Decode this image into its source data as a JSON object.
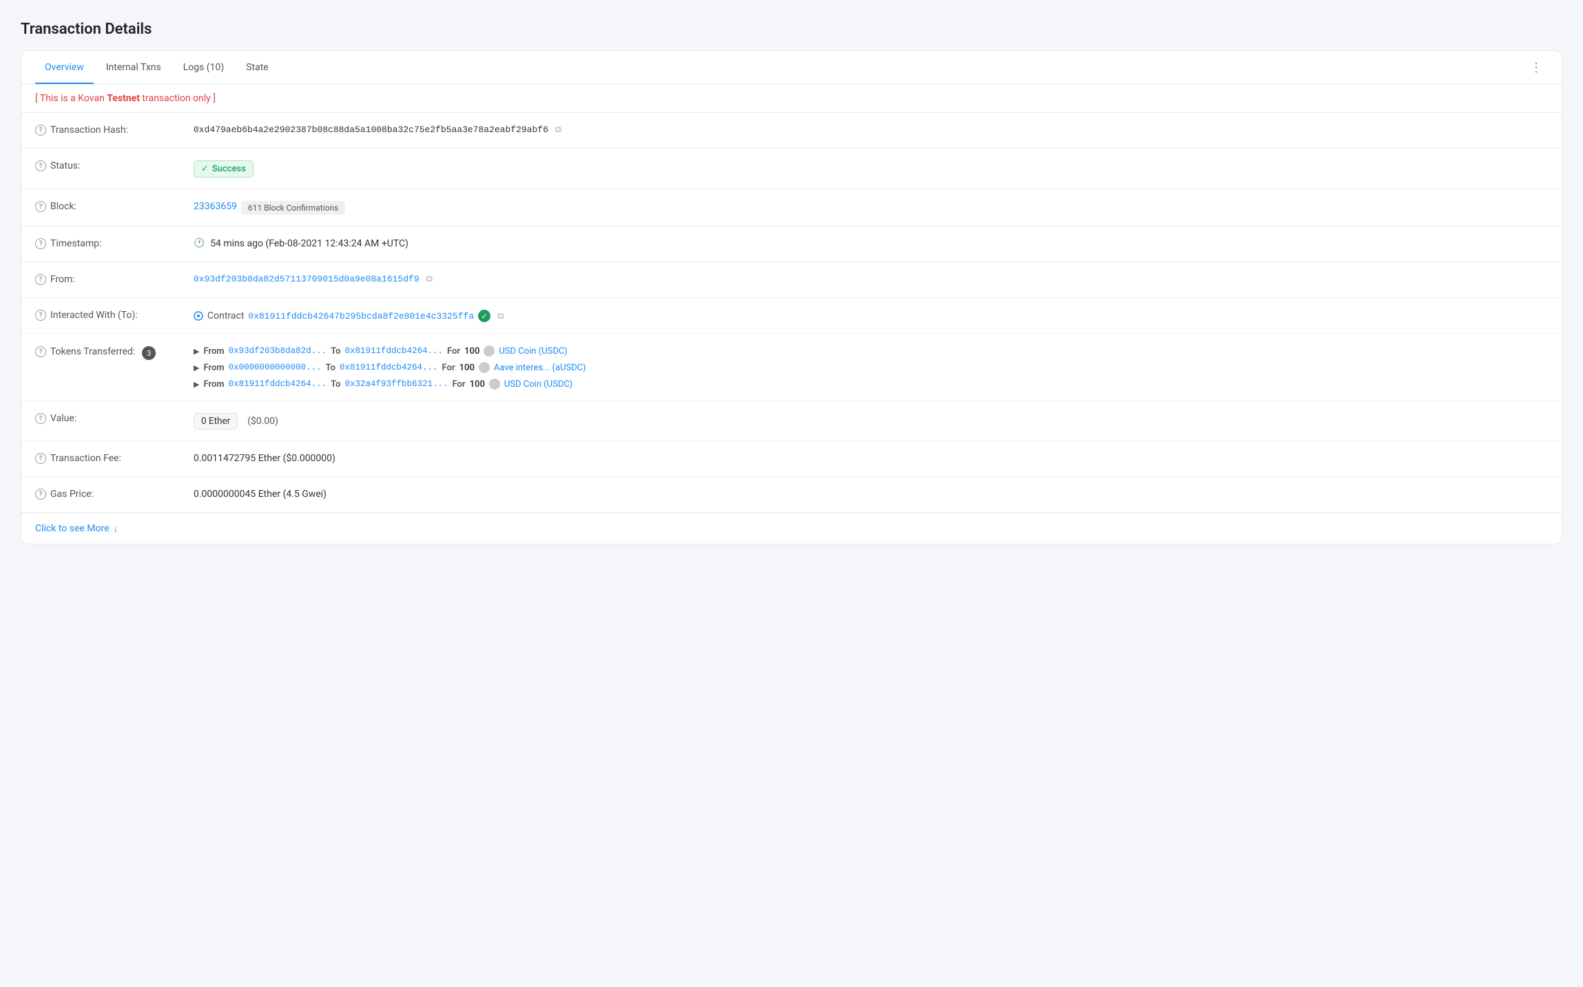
{
  "page": {
    "title": "Transaction Details"
  },
  "tabs": {
    "items": [
      {
        "label": "Overview",
        "active": true
      },
      {
        "label": "Internal Txns",
        "active": false
      },
      {
        "label": "Logs (10)",
        "active": false
      },
      {
        "label": "State",
        "active": false
      }
    ]
  },
  "testnet_banner": "[ This is a Kovan ",
  "testnet_brand": "Testnet",
  "testnet_suffix": " transaction only ]",
  "rows": {
    "tx_hash_label": "Transaction Hash:",
    "tx_hash_value": "0xd479aeb6b4a2e2902387b08c88da5a1008ba32c75e2fb5aa3e78a2eabf29abf6",
    "status_label": "Status:",
    "status_value": "Success",
    "block_label": "Block:",
    "block_number": "23363659",
    "block_confirmations": "611 Block Confirmations",
    "timestamp_label": "Timestamp:",
    "timestamp_icon": "🕐",
    "timestamp_value": "54 mins ago (Feb-08-2021 12:43:24 AM +UTC)",
    "from_label": "From:",
    "from_value": "0x93df203b8da82d57113709015d0a9e08a1615df9",
    "interacted_label": "Interacted With (To):",
    "contract_prefix": "Contract",
    "contract_address": "0x81911fddcb42647b295bcda8f2e801e4c3325ffa",
    "tokens_label": "Tokens Transferred:",
    "tokens_count": "3",
    "tokens": [
      {
        "from_addr": "0x93df203b8da82d...",
        "to_addr": "0x81911fddcb4264...",
        "amount": "100",
        "token_name": "USD Coin (USDC)"
      },
      {
        "from_addr": "0x0000000000000...",
        "to_addr": "0x81911fddcb4264...",
        "amount": "100",
        "token_name": "Aave interes... (aUSDC)"
      },
      {
        "from_addr": "0x81911fddcb4264...",
        "to_addr": "0x32a4f93ffbb6321...",
        "amount": "100",
        "token_name": "USD Coin (USDC)"
      }
    ],
    "value_label": "Value:",
    "value_eth": "0 Ether",
    "value_usd": "($0.00)",
    "fee_label": "Transaction Fee:",
    "fee_value": "0.0011472795 Ether ($0.000000)",
    "gas_label": "Gas Price:",
    "gas_value": "0.0000000045 Ether (4.5 Gwei)",
    "click_more": "Click to see More"
  },
  "icons": {
    "question": "?",
    "copy": "⧉",
    "check": "✓",
    "clock": "🕐",
    "verified": "✓",
    "arrow_right": "▶",
    "arrow_down": "↓",
    "more_dots": "⋮"
  }
}
